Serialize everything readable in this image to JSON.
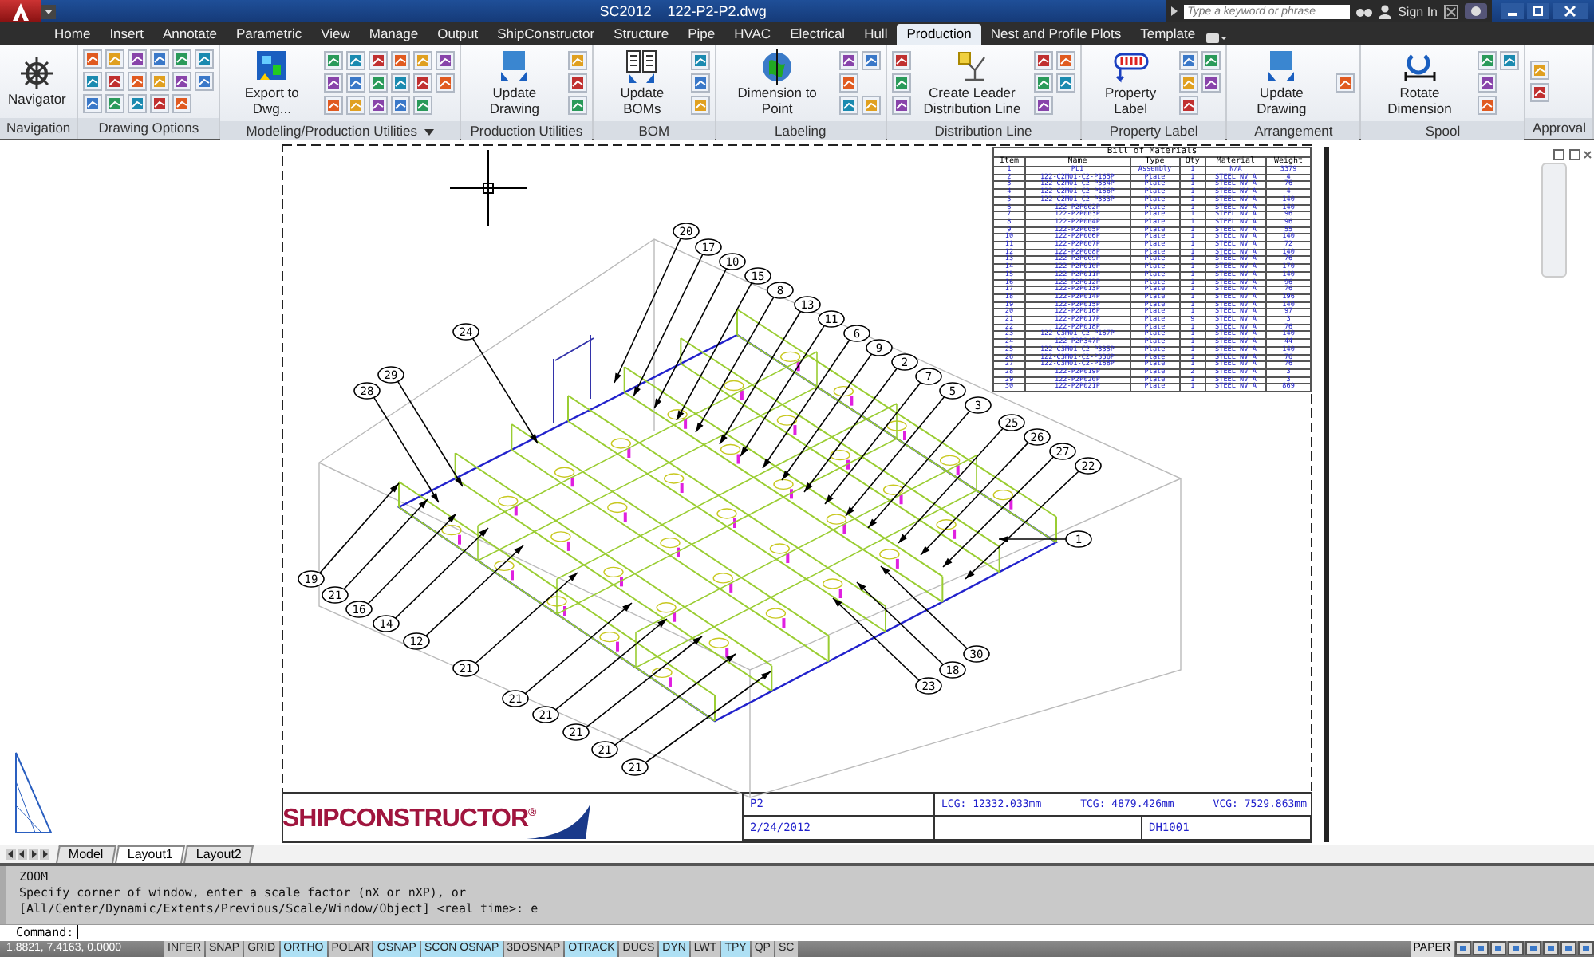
{
  "title_bar": {
    "app": "SC2012",
    "file": "122-P2-P2.dwg",
    "search": {
      "placeholder": "Type a keyword or phrase"
    },
    "sign_in": "Sign In"
  },
  "tabs": [
    {
      "label": "Home",
      "selected": false
    },
    {
      "label": "Insert",
      "selected": false
    },
    {
      "label": "Annotate",
      "selected": false
    },
    {
      "label": "Parametric",
      "selected": false
    },
    {
      "label": "View",
      "selected": false
    },
    {
      "label": "Manage",
      "selected": false
    },
    {
      "label": "Output",
      "selected": false
    },
    {
      "label": "ShipConstructor",
      "selected": false
    },
    {
      "label": "Structure",
      "selected": false
    },
    {
      "label": "Pipe",
      "selected": false
    },
    {
      "label": "HVAC",
      "selected": false
    },
    {
      "label": "Electrical",
      "selected": false
    },
    {
      "label": "Hull",
      "selected": false
    },
    {
      "label": "Production",
      "selected": true
    },
    {
      "label": "Nest and Profile Plots",
      "selected": false
    },
    {
      "label": "Template",
      "selected": false
    }
  ],
  "ribbon_panels": [
    {
      "title": "Navigation",
      "items": [
        {
          "kind": "large",
          "label": "Navigator"
        }
      ]
    },
    {
      "title": "Drawing Options",
      "items": [
        {
          "kind": "grid"
        }
      ]
    },
    {
      "title": "Modeling/Production Utilities",
      "dropdown": true,
      "items": [
        {
          "kind": "large",
          "label": "Export to Dwg..."
        },
        {
          "kind": "grid"
        }
      ]
    },
    {
      "title": "Production Utilities",
      "items": [
        {
          "kind": "large",
          "label": "Update Drawing"
        },
        {
          "kind": "grid"
        }
      ]
    },
    {
      "title": "BOM",
      "items": [
        {
          "kind": "large",
          "label": "Update BOMs"
        },
        {
          "kind": "grid"
        }
      ]
    },
    {
      "title": "Labeling",
      "items": [
        {
          "kind": "large",
          "label": "Dimension to Point"
        },
        {
          "kind": "grid"
        }
      ]
    },
    {
      "title": "Distribution Line",
      "items": [
        {
          "kind": "grid"
        },
        {
          "kind": "large",
          "label": "Create Leader Distribution Line"
        },
        {
          "kind": "grid"
        }
      ]
    },
    {
      "title": "Property Label",
      "items": [
        {
          "kind": "large",
          "label": "Property Label"
        },
        {
          "kind": "grid"
        }
      ]
    },
    {
      "title": "Arrangement",
      "items": [
        {
          "kind": "large",
          "label": "Update Drawing"
        },
        {
          "kind": "grid"
        }
      ]
    },
    {
      "title": "Spool",
      "items": [
        {
          "kind": "large",
          "label": "Rotate Dimension"
        },
        {
          "kind": "grid"
        }
      ]
    },
    {
      "title": "Approval",
      "items": [
        {
          "kind": "grid"
        }
      ]
    }
  ],
  "bom": {
    "title": "Bill of Materials",
    "columns": [
      "Item",
      "Name",
      "Type",
      "Qty",
      "Material",
      "Weight"
    ],
    "rows": [
      [
        "1",
        "PL1",
        "Assembly",
        "1",
        "N/A",
        "3379"
      ],
      [
        "2",
        "122-C2M01-C2-P165P",
        "Plate",
        "1",
        "STEEL NV A",
        "4"
      ],
      [
        "3",
        "122-C2M01-C2-P334P",
        "Plate",
        "1",
        "STEEL NV A",
        "76"
      ],
      [
        "4",
        "122-C2M01-C2-P166P",
        "Plate",
        "1",
        "STEEL NV A",
        "4"
      ],
      [
        "5",
        "122-C2M01-C2-P333P",
        "Plate",
        "1",
        "STEEL NV A",
        "140"
      ],
      [
        "6",
        "122-P2P002P",
        "Plate",
        "1",
        "STEEL NV A",
        "140"
      ],
      [
        "7",
        "122-P2P003P",
        "Plate",
        "1",
        "STEEL NV A",
        "96"
      ],
      [
        "8",
        "122-P2P004P",
        "Plate",
        "1",
        "STEEL NV A",
        "96"
      ],
      [
        "9",
        "122-P2P005P",
        "Plate",
        "1",
        "STEEL NV A",
        "55"
      ],
      [
        "10",
        "122-P2P006P",
        "Plate",
        "1",
        "STEEL NV A",
        "140"
      ],
      [
        "11",
        "122-P2P007P",
        "Plate",
        "1",
        "STEEL NV A",
        "72"
      ],
      [
        "12",
        "122-P2P008P",
        "Plate",
        "1",
        "STEEL NV A",
        "140"
      ],
      [
        "13",
        "122-P2P009P",
        "Plate",
        "1",
        "STEEL NV A",
        "76"
      ],
      [
        "14",
        "122-P2P010P",
        "Plate",
        "1",
        "STEEL NV A",
        "170"
      ],
      [
        "15",
        "122-P2P011P",
        "Plate",
        "1",
        "STEEL NV A",
        "140"
      ],
      [
        "16",
        "122-P2P012P",
        "Plate",
        "1",
        "STEEL NV A",
        "96"
      ],
      [
        "17",
        "122-P2P013P",
        "Plate",
        "1",
        "STEEL NV A",
        "76"
      ],
      [
        "18",
        "122-P2P014P",
        "Plate",
        "1",
        "STEEL NV A",
        "196"
      ],
      [
        "19",
        "122-P2P015P",
        "Plate",
        "1",
        "STEEL NV A",
        "140"
      ],
      [
        "20",
        "122-P2P016P",
        "Plate",
        "1",
        "STEEL NV A",
        "97"
      ],
      [
        "21",
        "122-P2P017P",
        "Plate",
        "9",
        "STEEL NV A",
        "3"
      ],
      [
        "22",
        "122-P2P018P",
        "Plate",
        "1",
        "STEEL NV A",
        "76"
      ],
      [
        "23",
        "122-C3M01-C2-P167P",
        "Plate",
        "1",
        "STEEL NV A",
        "140"
      ],
      [
        "24",
        "122-P2P347P",
        "Plate",
        "1",
        "STEEL NV A",
        "44"
      ],
      [
        "25",
        "122-C3M01-C2-P335P",
        "Plate",
        "1",
        "STEEL NV A",
        "140"
      ],
      [
        "26",
        "122-C3M01-C2-P336P",
        "Plate",
        "1",
        "STEEL NV A",
        "76"
      ],
      [
        "27",
        "122-C3M01-C2-P168P",
        "Plate",
        "1",
        "STEEL NV A",
        "76"
      ],
      [
        "28",
        "122-P2P019P",
        "Plate",
        "2",
        "STEEL NV A",
        "3"
      ],
      [
        "29",
        "122-P2P020P",
        "Plate",
        "1",
        "STEEL NV A",
        "3"
      ],
      [
        "30",
        "122-P2P021P",
        "Plate",
        "1",
        "STEEL NV A",
        "869"
      ]
    ]
  },
  "balloons": [
    {
      "label": "20"
    },
    {
      "label": "17"
    },
    {
      "label": "10"
    },
    {
      "label": "15"
    },
    {
      "label": "8"
    },
    {
      "label": "13"
    },
    {
      "label": "11"
    },
    {
      "label": "6"
    },
    {
      "label": "9"
    },
    {
      "label": "2"
    },
    {
      "label": "7"
    },
    {
      "label": "5"
    },
    {
      "label": "3"
    },
    {
      "label": "25"
    },
    {
      "label": "26"
    },
    {
      "label": "27"
    },
    {
      "label": "22"
    },
    {
      "label": "24"
    },
    {
      "label": "29"
    },
    {
      "label": "28"
    },
    {
      "label": "19"
    },
    {
      "label": "21"
    },
    {
      "label": "16"
    },
    {
      "label": "14"
    },
    {
      "label": "12"
    },
    {
      "label": "21"
    },
    {
      "label": "21"
    },
    {
      "label": "21"
    },
    {
      "label": "21"
    },
    {
      "label": "21"
    },
    {
      "label": "21"
    },
    {
      "label": "1"
    },
    {
      "label": "30"
    },
    {
      "label": "18"
    },
    {
      "label": "23"
    }
  ],
  "title_block": {
    "logo": "SHIPCONSTRUCTOR$^{®}$",
    "drawing": "P2",
    "date": "2/24/2012",
    "lcg": "LCG: 12332.033mm",
    "tcg": "TCG: 4879.426mm",
    "vcg": "VCG: 7529.863mm",
    "number": "DH1001"
  },
  "layout_tabs": [
    {
      "label": "Model",
      "selected": false
    },
    {
      "label": "Layout1",
      "selected": true
    },
    {
      "label": "Layout2",
      "selected": false
    }
  ],
  "command_history": [
    "ZOOM",
    "Specify corner of window, enter a scale factor (nX or nXP), or",
    "[All/Center/Dynamic/Extents/Previous/Scale/Window/Object] <real time>: e"
  ],
  "command_prompt": "Command:",
  "status_bar": {
    "coordinates": "1.8821, 7.4163, 0.0000",
    "toggles": [
      {
        "label": "INFER",
        "on": false
      },
      {
        "label": "SNAP",
        "on": false
      },
      {
        "label": "GRID",
        "on": false
      },
      {
        "label": "ORTHO",
        "on": true
      },
      {
        "label": "POLAR",
        "on": false
      },
      {
        "label": "OSNAP",
        "on": true
      },
      {
        "label": "SCON OSNAP",
        "on": true
      },
      {
        "label": "3DOSNAP",
        "on": false
      },
      {
        "label": "OTRACK",
        "on": true
      },
      {
        "label": "DUCS",
        "on": false
      },
      {
        "label": "DYN",
        "on": true
      },
      {
        "label": "LWT",
        "on": false
      },
      {
        "label": "TPY",
        "on": true
      },
      {
        "label": "QP",
        "on": false
      },
      {
        "label": "SC",
        "on": false
      }
    ],
    "space": "PAPER"
  }
}
